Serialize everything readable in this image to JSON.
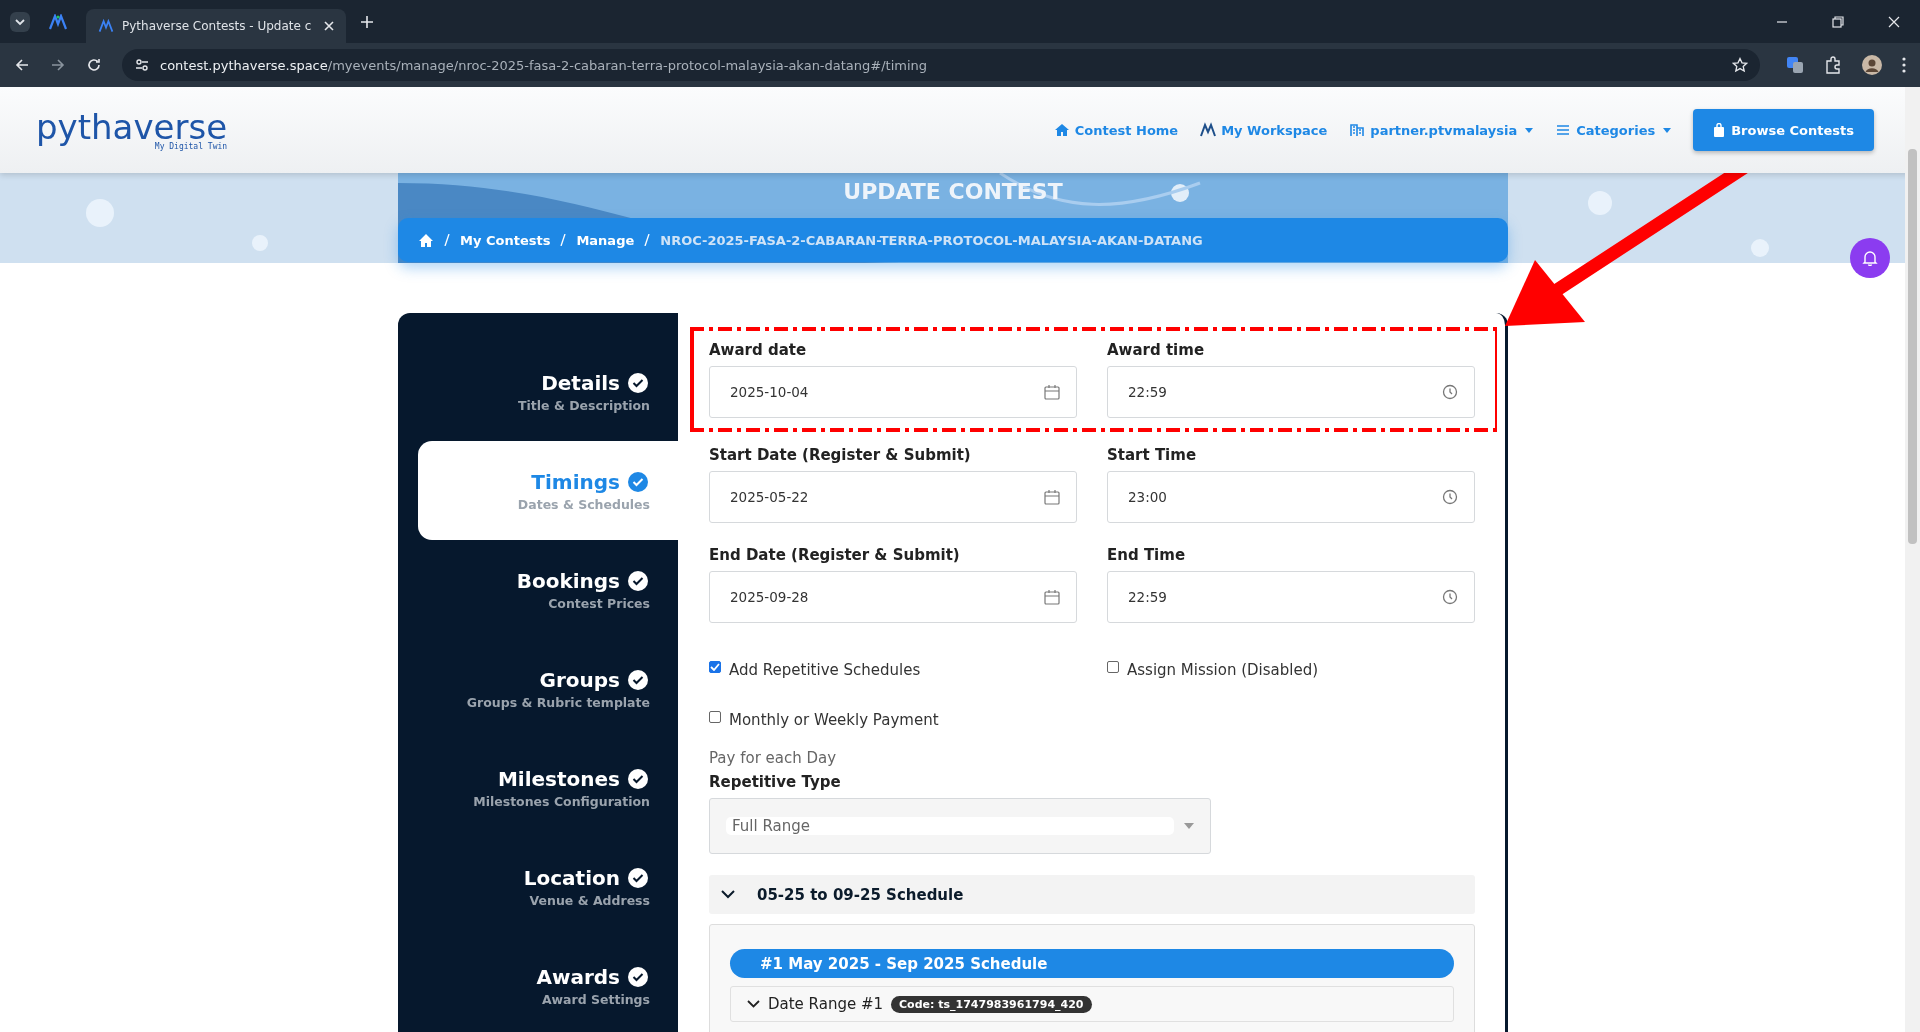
{
  "browser": {
    "tabs": [
      {
        "title": "Pythaverse Contests - Update c",
        "selected": true
      }
    ],
    "url_host": "contest.pythaverse.space",
    "url_path": "/myevents/manage/nroc-2025-fasa-2-cabaran-terra-protocol-malaysia-akan-datang#/timing"
  },
  "header": {
    "logo": {
      "name": "pythaverse",
      "tagline": "My Digital Twin"
    },
    "nav": [
      {
        "label": "Contest Home",
        "kind": "home",
        "dropdown": false
      },
      {
        "label": "My Workspace",
        "kind": "workspace",
        "dropdown": false
      },
      {
        "label": "partner.ptvmalaysia",
        "kind": "building",
        "dropdown": true
      },
      {
        "label": "Categories",
        "kind": "list",
        "dropdown": true
      }
    ],
    "button": "Browse Contests"
  },
  "banner": {
    "title": "UPDATE CONTEST",
    "breadcrumb": [
      "My Contests",
      "Manage",
      "NROC-2025-FASA-2-CABARAN-TERRA-PROTOCOL-MALAYSIA-AKAN-DATANG"
    ]
  },
  "steps": [
    {
      "title": "Details",
      "subtitle": "Title & Description",
      "done": true,
      "selected": false
    },
    {
      "title": "Timings",
      "subtitle": "Dates & Schedules",
      "done": true,
      "selected": true
    },
    {
      "title": "Bookings",
      "subtitle": "Contest Prices",
      "done": true,
      "selected": false
    },
    {
      "title": "Groups",
      "subtitle": "Groups & Rubric template",
      "done": true,
      "selected": false
    },
    {
      "title": "Milestones",
      "subtitle": "Milestones Configuration",
      "done": true,
      "selected": false
    },
    {
      "title": "Location",
      "subtitle": "Venue & Address",
      "done": true,
      "selected": false
    },
    {
      "title": "Awards",
      "subtitle": "Award Settings",
      "done": true,
      "selected": false
    }
  ],
  "field_rows": [
    {
      "highlighted": true,
      "fields": [
        {
          "label": "Award date",
          "value": "2025-10-04",
          "kind": "date"
        },
        {
          "label": "Award time",
          "value": "22:59",
          "kind": "time"
        }
      ]
    },
    {
      "highlighted": false,
      "fields": [
        {
          "label": "Start Date (Register & Submit)",
          "value": "2025-05-22",
          "kind": "date"
        },
        {
          "label": "Start Time",
          "value": "23:00",
          "kind": "time"
        }
      ]
    },
    {
      "highlighted": false,
      "fields": [
        {
          "label": "End Date (Register & Submit)",
          "value": "2025-09-28",
          "kind": "date"
        },
        {
          "label": "End Time",
          "value": "22:59",
          "kind": "time"
        }
      ]
    }
  ],
  "options": [
    {
      "label": "Add Repetitive Schedules",
      "checked": true
    },
    {
      "label": "Assign Mission (Disabled)",
      "checked": false
    },
    {
      "label": "Monthly or Weekly Payment",
      "checked": false
    }
  ],
  "payment_note": "Pay for each Day",
  "repetitive_type": {
    "label": "Repetitive Type",
    "value": "Full Range"
  },
  "schedule": {
    "title": "05-25 to 09-25 Schedule",
    "expanded": true,
    "item": "#1 May 2025 - Sep 2025 Schedule",
    "date_range": {
      "label": "Date Range #1",
      "code": "Code: ts_1747983961794_420",
      "expanded": true
    }
  }
}
